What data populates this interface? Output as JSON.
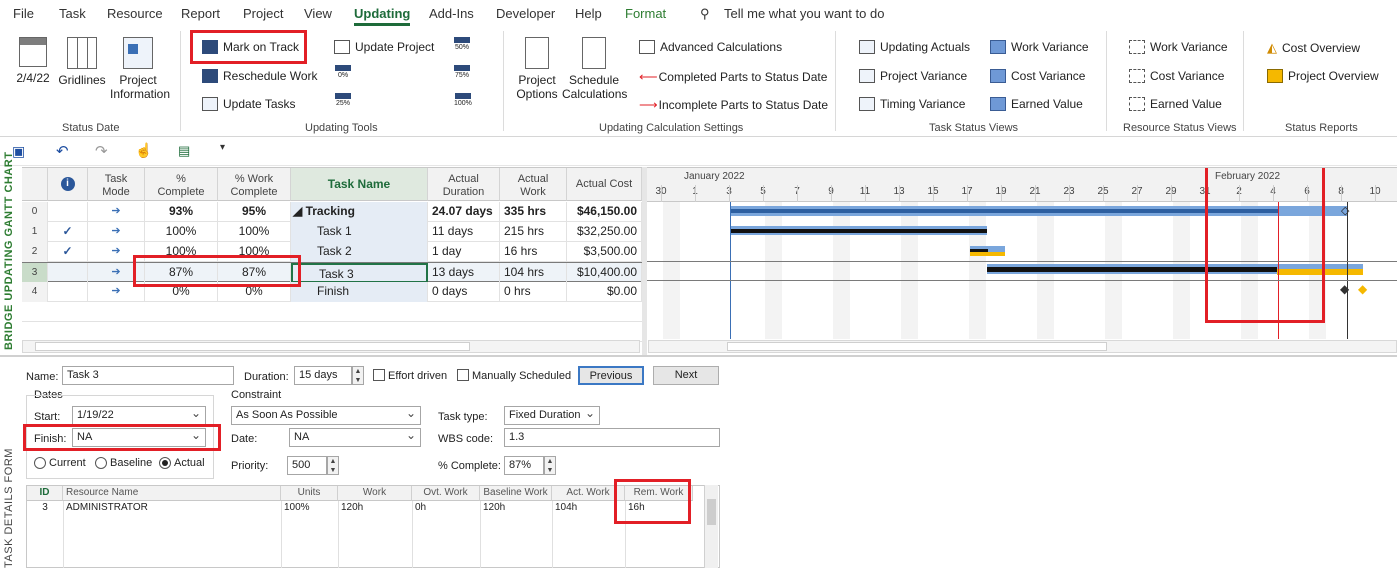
{
  "menu": {
    "tabs": [
      "File",
      "Task",
      "Resource",
      "Report",
      "Project",
      "View",
      "Updating",
      "Add-Ins",
      "Developer",
      "Help",
      "Format"
    ],
    "active": "Updating",
    "tell_me": "Tell me what you want to do"
  },
  "ribbon": {
    "status_date": {
      "date_label": "2/4/22",
      "gridlines": "Gridlines",
      "project_info": [
        "Project",
        "Information"
      ],
      "group": "Status Date"
    },
    "updating_tools": {
      "mark_on_track": "Mark on Track",
      "reschedule_work": "Reschedule Work",
      "update_tasks": "Update Tasks",
      "update_project": "Update Project",
      "pct_labels": [
        "50%",
        "0%",
        "75%",
        "25%",
        "100%"
      ],
      "group": "Updating Tools"
    },
    "calc": {
      "project_options": [
        "Project",
        "Options"
      ],
      "schedule_calc": [
        "Schedule",
        "Calculations"
      ],
      "advanced": "Advanced Calculations",
      "completed_parts": "Completed Parts to Status Date",
      "incomplete_parts": "Incomplete Parts to Status Date",
      "group": "Updating Calculation Settings"
    },
    "task_views": {
      "items": [
        "Updating Actuals",
        "Project Variance",
        "Timing Variance",
        "Work Variance",
        "Cost Variance",
        "Earned Value"
      ],
      "group": "Task Status Views"
    },
    "resource_views": {
      "items": [
        "Work Variance",
        "Cost Variance",
        "Earned Value"
      ],
      "group": "Resource Status Views"
    },
    "reports": {
      "items": [
        "Cost Overview",
        "Project Overview"
      ],
      "group": "Status Reports"
    }
  },
  "view_labels": {
    "top": "BRIDGE UPDATING GANTT CHART",
    "bottom": "TASK DETAILS FORM"
  },
  "grid": {
    "headers": {
      "task_mode": [
        "Task",
        "Mode"
      ],
      "pct_complete": [
        "%",
        "Complete"
      ],
      "pct_work": [
        "% Work",
        "Complete"
      ],
      "task_name": "Task Name",
      "actual_duration": [
        "Actual",
        "Duration"
      ],
      "actual_work": [
        "Actual",
        "Work"
      ],
      "actual_cost": "Actual Cost"
    },
    "rows": [
      {
        "id": "0",
        "done": false,
        "pct": "93%",
        "pctwork": "95%",
        "name": "Tracking",
        "dur": "24.07 days",
        "work": "335 hrs",
        "cost": "$46,150.00",
        "summary": true
      },
      {
        "id": "1",
        "done": true,
        "pct": "100%",
        "pctwork": "100%",
        "name": "Task 1",
        "dur": "11 days",
        "work": "215 hrs",
        "cost": "$32,250.00"
      },
      {
        "id": "2",
        "done": true,
        "pct": "100%",
        "pctwork": "100%",
        "name": "Task 2",
        "dur": "1 day",
        "work": "16 hrs",
        "cost": "$3,500.00"
      },
      {
        "id": "3",
        "done": false,
        "pct": "87%",
        "pctwork": "87%",
        "name": "Task 3",
        "dur": "13 days",
        "work": "104 hrs",
        "cost": "$10,400.00"
      },
      {
        "id": "4",
        "done": false,
        "pct": "0%",
        "pctwork": "0%",
        "name": "Finish",
        "dur": "0 days",
        "work": "0 hrs",
        "cost": "$0.00"
      }
    ]
  },
  "gantt": {
    "months": [
      "January 2022",
      "February 2022"
    ],
    "days": [
      "30",
      "1",
      "3",
      "5",
      "7",
      "9",
      "11",
      "13",
      "15",
      "17",
      "19",
      "21",
      "23",
      "25",
      "27",
      "29",
      "31",
      "2",
      "4",
      "6",
      "8",
      "10"
    ],
    "colors": {
      "baseline": "#7aa6dc",
      "actual": "#111111",
      "remaining": "#f5b800",
      "status_line": "#e21f26"
    }
  },
  "form": {
    "name_label": "Name:",
    "name": "Task 3",
    "duration_label": "Duration:",
    "duration": "15 days",
    "effort_driven": "Effort driven",
    "manually_scheduled": "Manually Scheduled",
    "previous": "Previous",
    "next": "Next",
    "dates_label": "Dates",
    "start_label": "Start:",
    "start": "1/19/22",
    "finish_label": "Finish:",
    "finish": "NA",
    "radios": [
      "Current",
      "Baseline",
      "Actual"
    ],
    "constraint_label": "Constraint",
    "constraint": "As Soon As Possible",
    "date_label": "Date:",
    "date": "NA",
    "priority_label": "Priority:",
    "priority": "500",
    "task_type_label": "Task type:",
    "task_type": "Fixed Duration",
    "wbs_label": "WBS code:",
    "wbs": "1.3",
    "pct_label": "% Complete:",
    "pct": "87%",
    "res_headers": [
      "ID",
      "Resource Name",
      "Units",
      "Work",
      "Ovt. Work",
      "Baseline Work",
      "Act. Work",
      "Rem. Work"
    ],
    "res_row": [
      "3",
      "ADMINISTRATOR",
      "100%",
      "120h",
      "0h",
      "120h",
      "104h",
      "16h"
    ]
  }
}
